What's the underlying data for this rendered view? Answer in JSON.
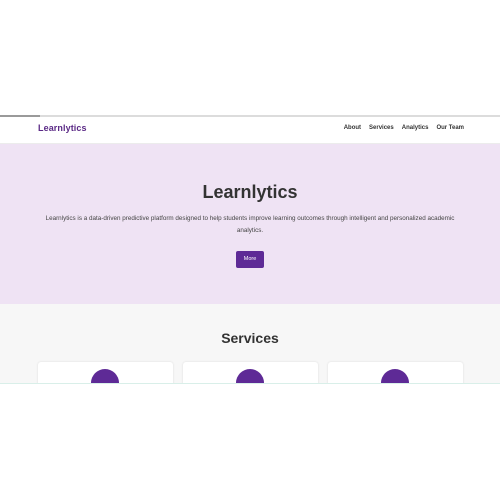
{
  "colors": {
    "brand": "#5b2a86",
    "accent": "#5e2a96",
    "hero_background": "#efe3f4",
    "services_background": "#f7f7f7"
  },
  "navbar": {
    "brand": "Learnlytics",
    "links": [
      "About",
      "Services",
      "Analytics",
      "Our Team"
    ]
  },
  "hero": {
    "title": "Learnlytics",
    "description": "Learnlytics is a data-driven predictive platform designed to help students improve learning outcomes through intelligent and personalized academic analytics.",
    "button_label": "More"
  },
  "services": {
    "title": "Services",
    "cards": [
      {
        "icon": "service-circle-icon"
      },
      {
        "icon": "service-circle-icon"
      },
      {
        "icon": "service-circle-icon"
      }
    ]
  }
}
